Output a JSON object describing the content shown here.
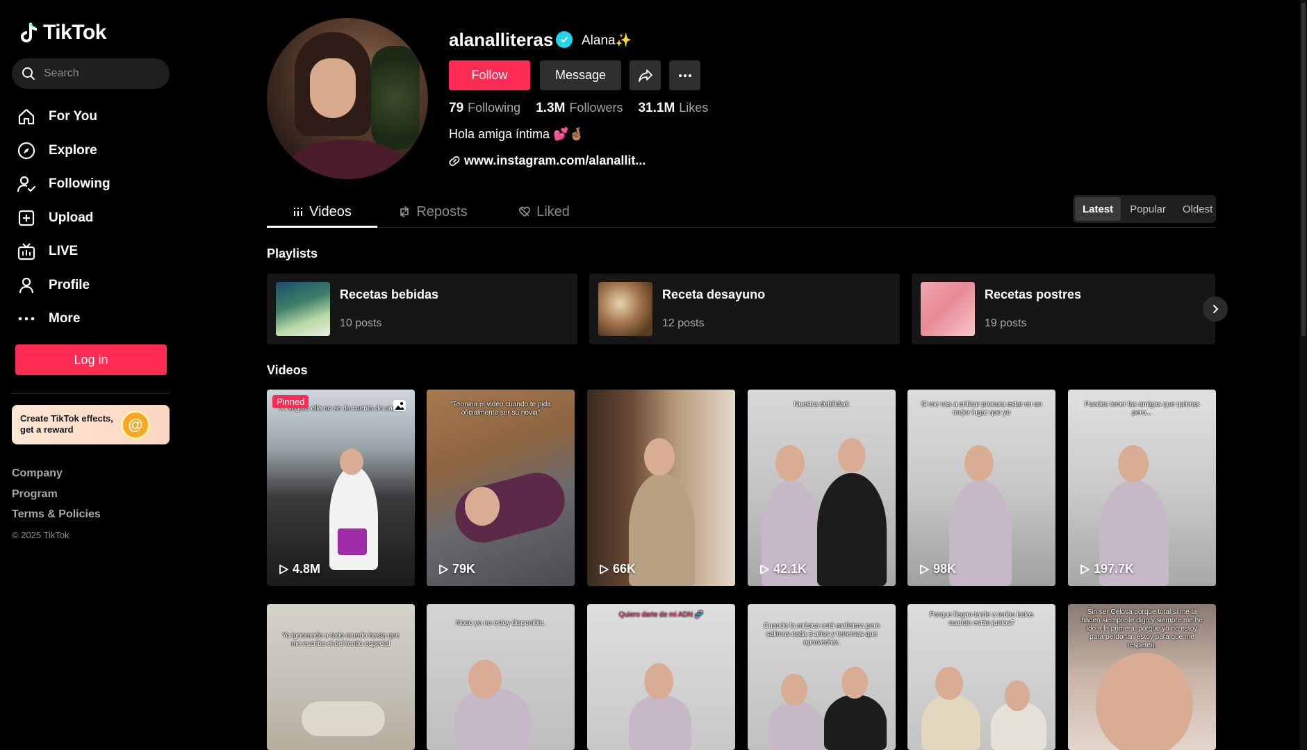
{
  "sidebar": {
    "logo": "TikTok",
    "search_placeholder": "Search",
    "nav": [
      {
        "label": "For You",
        "icon": "home-icon"
      },
      {
        "label": "Explore",
        "icon": "compass-icon"
      },
      {
        "label": "Following",
        "icon": "following-icon"
      },
      {
        "label": "Upload",
        "icon": "upload-icon"
      },
      {
        "label": "LIVE",
        "icon": "live-icon"
      },
      {
        "label": "Profile",
        "icon": "profile-icon"
      },
      {
        "label": "More",
        "icon": "more-icon"
      }
    ],
    "login_label": "Log in",
    "effects_card": "Create TikTok effects, get a reward",
    "footer": [
      "Company",
      "Program",
      "Terms & Policies"
    ],
    "copyright": "© 2025 TikTok"
  },
  "profile": {
    "username": "alanalliteras",
    "nickname": "Alana✨",
    "follow_label": "Follow",
    "message_label": "Message",
    "stats": {
      "following_count": "79",
      "following_label": "Following",
      "followers_count": "1.3M",
      "followers_label": "Followers",
      "likes_count": "31.1M",
      "likes_label": "Likes"
    },
    "bio": "Hola amiga íntima 💕🤞🏽",
    "link": "www.instagram.com/alanallit..."
  },
  "tabs": [
    {
      "label": "Videos",
      "active": true
    },
    {
      "label": "Reposts",
      "active": false
    },
    {
      "label": "Liked",
      "active": false
    }
  ],
  "sort": [
    {
      "label": "Latest",
      "active": true
    },
    {
      "label": "Popular",
      "active": false
    },
    {
      "label": "Oldest",
      "active": false
    }
  ],
  "playlists_title": "Playlists",
  "playlists": [
    {
      "name": "Recetas bebidas",
      "count": "10 posts"
    },
    {
      "name": "Receta desayuno",
      "count": "12 posts"
    },
    {
      "name": "Recetas postres",
      "count": "19 posts"
    }
  ],
  "videos_title": "Videos",
  "pinned_label": "Pinned",
  "videos_row1": [
    {
      "caption": "X: seguro ella no se da cuenta de nada.",
      "views": "4.8M"
    },
    {
      "caption": "\"Termina el video cuando te pida oficialmente ser su novia\"",
      "views": "79K"
    },
    {
      "caption": "",
      "views": "66K"
    },
    {
      "caption": "Nuestra debilidad:",
      "views": "42.1K"
    },
    {
      "caption": "Si me vas a criticar procura estar en un mejor lugar que yo",
      "views": "98K"
    },
    {
      "caption": "Puedes tener las amigas que quieras pero...",
      "views": "197.7K"
    }
  ],
  "videos_row2": [
    {
      "caption": "Yo ignorando a todo mundo hasta que me escribe el del tonito especial"
    },
    {
      "caption": "Nono yo no estoy disponible."
    },
    {
      "caption": "Quiero darte de mi ADN 🧬"
    },
    {
      "caption": "Cuando la música está malísima pero salimos cada 3 años y tenemos que aprovechar."
    },
    {
      "caption": "Porque llegan tarde a todos lados cuando están juntos?"
    },
    {
      "caption": "Sin ser Celosa porque total si me la hacen siempre le digo y siempre me he ido a la primera, porque yo no estoy para perdonar, estoy para que me respeten."
    }
  ],
  "colors": {
    "accent": "#fe2c55",
    "verified": "#20d5ec"
  }
}
